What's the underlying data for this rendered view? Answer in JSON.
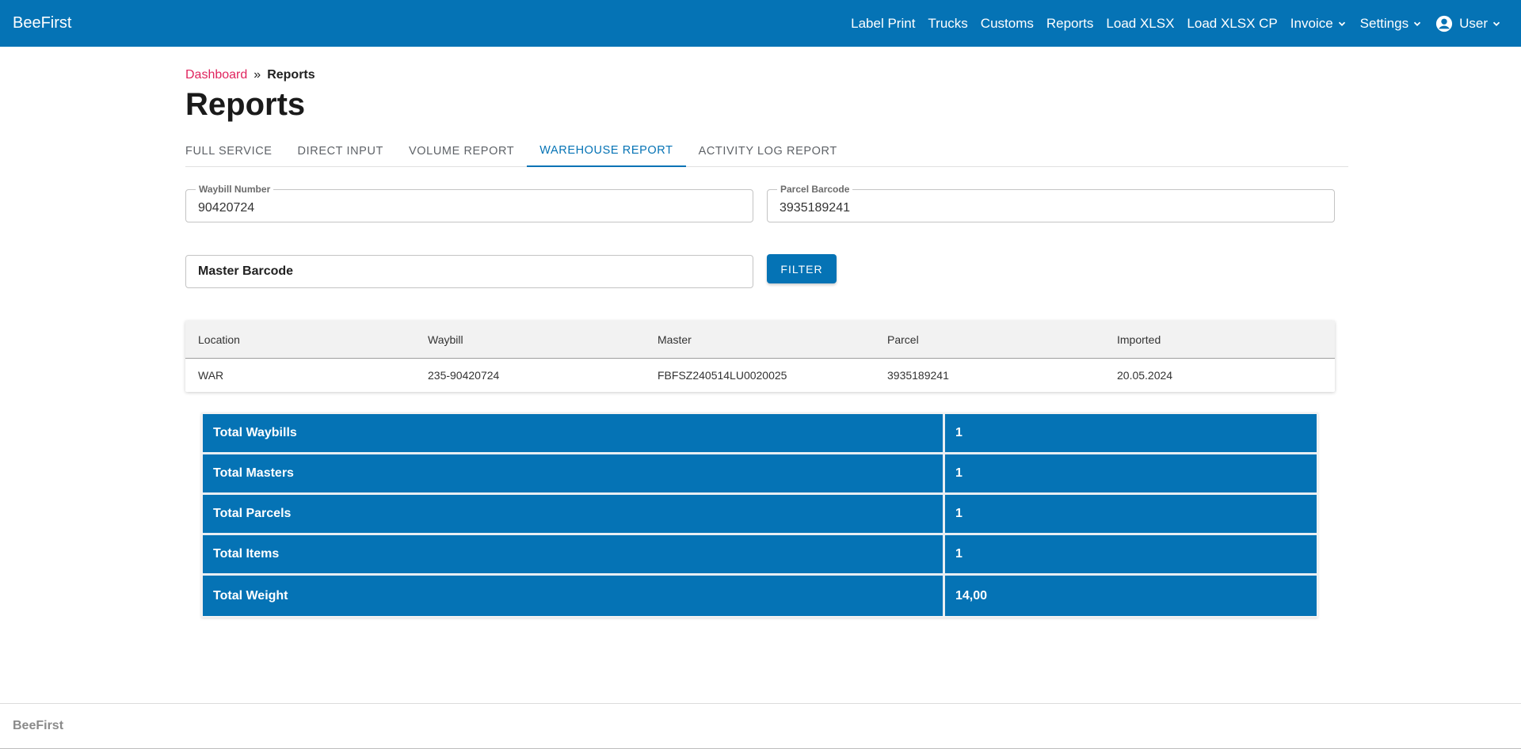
{
  "navbar": {
    "brand": "BeeFirst",
    "links": [
      "Label Print",
      "Trucks",
      "Customs",
      "Reports",
      "Load XLSX",
      "Load XLSX CP"
    ],
    "invoice": "Invoice",
    "settings": "Settings",
    "user": "User"
  },
  "breadcrumb": {
    "home": "Dashboard",
    "separator": "»",
    "current": "Reports"
  },
  "page_title": "Reports",
  "tabs": [
    "Full Service",
    "Direct Input",
    "Volume Report",
    "Warehouse Report",
    "Activity Log Report"
  ],
  "active_tab": "Warehouse Report",
  "filters": {
    "waybill_label": "Waybill Number",
    "waybill_value": "90420724",
    "parcel_label": "Parcel Barcode",
    "parcel_value": "3935189241",
    "master_placeholder": "Master Barcode",
    "filter_button": "Filter"
  },
  "table": {
    "headers": [
      "Location",
      "Waybill",
      "Master",
      "Parcel",
      "Imported"
    ],
    "rows": [
      [
        "WAR",
        "235-90420724",
        "FBFSZ240514LU0020025",
        "3935189241",
        "20.05.2024"
      ]
    ]
  },
  "totals": [
    {
      "label": "Total Waybills",
      "value": "1"
    },
    {
      "label": "Total Masters",
      "value": "1"
    },
    {
      "label": "Total Parcels",
      "value": "1"
    },
    {
      "label": "Total Items",
      "value": "1"
    },
    {
      "label": "Total Weight",
      "value": "14,00"
    }
  ],
  "footer": {
    "brand": "BeeFirst"
  },
  "colors": {
    "primary": "#0573b5",
    "link": "#e0245e"
  }
}
